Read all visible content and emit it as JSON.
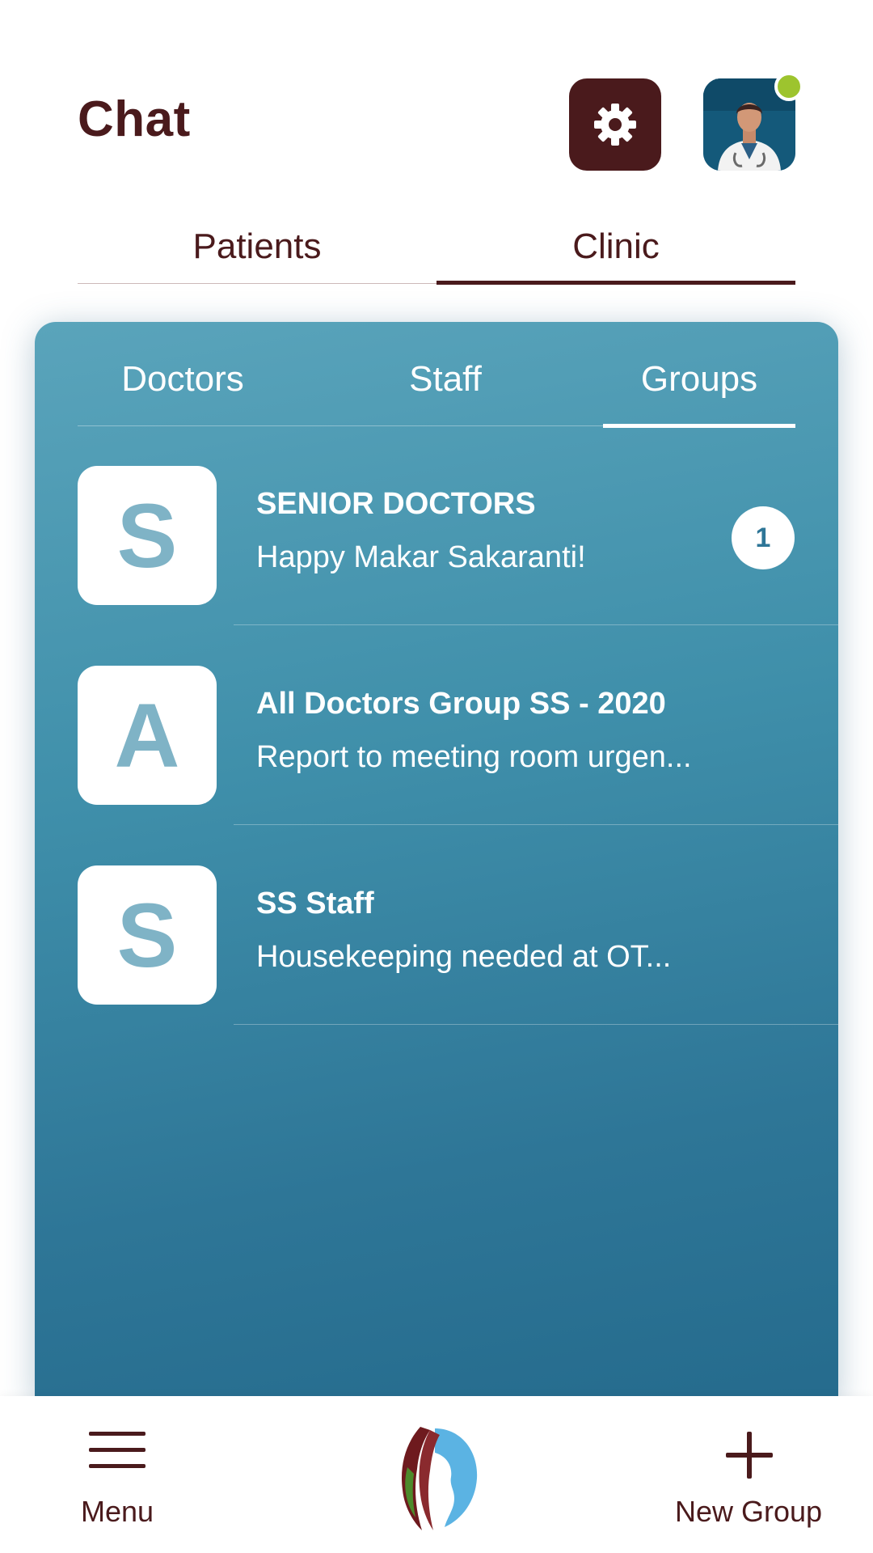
{
  "header": {
    "title": "Chat",
    "settings_icon": "gear-icon",
    "avatar_icon": "doctor-avatar",
    "status": "online",
    "colors": {
      "primary": "#4a1a1c",
      "online": "#9dc42e"
    }
  },
  "top_tabs": [
    {
      "label": "Patients",
      "active": false
    },
    {
      "label": "Clinic",
      "active": true
    }
  ],
  "sub_tabs": [
    {
      "label": "Doctors",
      "active": false
    },
    {
      "label": "Staff",
      "active": false
    },
    {
      "label": "Groups",
      "active": true
    }
  ],
  "groups": [
    {
      "initial": "S",
      "name": "SENIOR DOCTORS",
      "last_message": "Happy Makar Sakaranti!",
      "unread": "1"
    },
    {
      "initial": "A",
      "name": "All Doctors Group SS - 2020",
      "last_message": "Report to meeting room urgen...",
      "unread": ""
    },
    {
      "initial": "S",
      "name": "SS Staff",
      "last_message": "Housekeeping needed at OT...",
      "unread": ""
    }
  ],
  "bottom_bar": {
    "menu_label": "Menu",
    "menu_icon": "hamburger-menu-icon",
    "logo_icon": "app-logo",
    "new_group_label": "New Group",
    "new_group_icon": "plus-icon"
  },
  "panel_colors": {
    "top": "#5aa4bb",
    "bottom": "#256b8d"
  }
}
